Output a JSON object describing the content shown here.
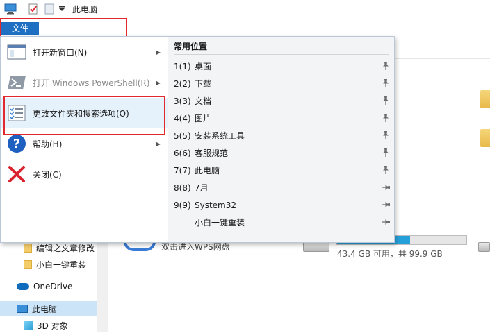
{
  "window": {
    "title": "此电脑"
  },
  "ribbon": {
    "file_tab_label": "文件"
  },
  "file_menu": {
    "items": [
      {
        "label": "打开新窗口(N)",
        "icon": "new-window-icon",
        "submenu": true,
        "enabled": true
      },
      {
        "label": "打开 Windows PowerShell(R)",
        "icon": "powershell-icon",
        "submenu": true,
        "enabled": false
      },
      {
        "label": "更改文件夹和搜索选项(O)",
        "icon": "folder-options-icon",
        "submenu": false,
        "enabled": true,
        "highlighted": true
      },
      {
        "label": "帮助(H)",
        "icon": "help-icon",
        "submenu": true,
        "enabled": true
      },
      {
        "label": "关闭(C)",
        "icon": "close-icon",
        "submenu": false,
        "enabled": true
      }
    ],
    "frequent_places": {
      "header": "常用位置",
      "items": [
        {
          "number": "1(1)",
          "name": "桌面",
          "pinned": true
        },
        {
          "number": "2(2)",
          "name": "下载",
          "pinned": true
        },
        {
          "number": "3(3)",
          "name": "文档",
          "pinned": true
        },
        {
          "number": "4(4)",
          "name": "图片",
          "pinned": true
        },
        {
          "number": "5(5)",
          "name": "安装系统工具",
          "pinned": true
        },
        {
          "number": "6(6)",
          "name": "客服规范",
          "pinned": true
        },
        {
          "number": "7(7)",
          "name": "此电脑",
          "pinned": true
        },
        {
          "number": "8(8)",
          "name": "7月",
          "pinned": false
        },
        {
          "number": "9(9)",
          "name": "System32",
          "pinned": false
        },
        {
          "number": "",
          "name": "小白一键重装",
          "pinned": false
        }
      ]
    }
  },
  "navigation_pane": {
    "items": [
      {
        "label": "编辑之文章修改",
        "icon": "folder-icon"
      },
      {
        "label": "小白一键重装",
        "icon": "folder-icon"
      },
      {
        "label": "OneDrive",
        "icon": "onedrive-icon"
      },
      {
        "label": "此电脑",
        "icon": "this-pc-icon",
        "selected": true
      },
      {
        "label": "3D 对象",
        "icon": "3d-objects-icon"
      }
    ]
  },
  "content": {
    "wps_label": "双击进入WPS网盘",
    "drive": {
      "usage_text": "43.4 GB 可用，共 99.9 GB",
      "used_fraction": 0.566
    }
  },
  "colors": {
    "accent": "#1f6fc3",
    "highlight_box": "#e2282f",
    "drive_fill": "#26a0da"
  }
}
